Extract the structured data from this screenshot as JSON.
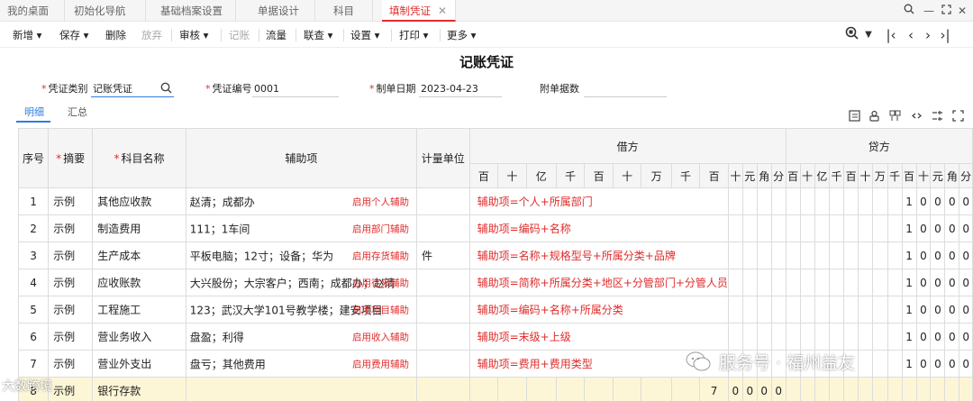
{
  "tabs": [
    {
      "label": "我的桌面"
    },
    {
      "label": "初始化导航"
    },
    {
      "label": "基础档案设置"
    },
    {
      "label": "单据设计"
    },
    {
      "label": "科目"
    },
    {
      "label": "填制凭证",
      "active": true
    }
  ],
  "toolbar": {
    "add": "新增",
    "save": "保存",
    "delete": "删除",
    "discard": "放弃",
    "review": "审核",
    "post": "记账",
    "flow": "流量",
    "query": "联查",
    "settings": "设置",
    "print": "打印",
    "more": "更多"
  },
  "voucher": {
    "title": "记账凭证",
    "type_label": "凭证类别",
    "type_value": "记账凭证",
    "number_label": "凭证编号",
    "number_value": "0001",
    "date_label": "制单日期",
    "date_value": "2023-04-23",
    "attach_label": "附单据数"
  },
  "subtabs": {
    "detail": "明细",
    "summary": "汇总"
  },
  "table": {
    "headers": {
      "seq": "序号",
      "summary": "摘要",
      "account": "科目名称",
      "aux": "辅助项",
      "unit": "计量单位",
      "debit": "借方",
      "credit": "贷方"
    },
    "digit_headers": [
      "百",
      "十",
      "亿",
      "千",
      "百",
      "十",
      "万",
      "千",
      "百",
      "十",
      "元",
      "角",
      "分"
    ],
    "rows": [
      {
        "seq": "1",
        "summary": "示例",
        "account": "其他应收款",
        "aux": "赵清；成都办",
        "aux_btn": "启用个人辅助",
        "unit": "",
        "rule": "辅助项=个人+所属部门",
        "debit_digits": "",
        "credit_digits": "10000"
      },
      {
        "seq": "2",
        "summary": "示例",
        "account": "制造费用",
        "aux": "111；1车间",
        "aux_btn": "启用部门辅助",
        "unit": "",
        "rule": "辅助项=编码+名称",
        "debit_digits": "",
        "credit_digits": "10000"
      },
      {
        "seq": "3",
        "summary": "示例",
        "account": "生产成本",
        "aux": "平板电脑；12寸；设备；华为",
        "aux_btn": "启用存货辅助",
        "unit": "件",
        "rule": "辅助项=名称+规格型号+所属分类+品牌",
        "debit_digits": "",
        "credit_digits": "10000"
      },
      {
        "seq": "4",
        "summary": "示例",
        "account": "应收账款",
        "aux": "大兴股份；大宗客户；西南；成都办；赵清",
        "aux_btn": "启用往来辅助",
        "unit": "",
        "rule": "辅助项=简称+所属分类+地区+分管部门+分管人员",
        "debit_digits": "",
        "credit_digits": "10000"
      },
      {
        "seq": "5",
        "summary": "示例",
        "account": "工程施工",
        "aux": "123；武汉大学101号教学楼；建安项目",
        "aux_btn": "启用项目辅助",
        "unit": "",
        "rule": "辅助项=编码+名称+所属分类",
        "debit_digits": "",
        "credit_digits": "10000"
      },
      {
        "seq": "6",
        "summary": "示例",
        "account": "营业务收入",
        "aux": "盘盈；利得",
        "aux_btn": "启用收入辅助",
        "unit": "",
        "rule": "辅助项=末级+上级",
        "debit_digits": "",
        "credit_digits": "10000"
      },
      {
        "seq": "7",
        "summary": "示例",
        "account": "营业外支出",
        "aux": "盘亏；其他费用",
        "aux_btn": "启用费用辅助",
        "unit": "",
        "rule": "辅助项=费用+费用类型",
        "debit_digits": "",
        "credit_digits": "10000"
      },
      {
        "seq": "8",
        "summary": "示例",
        "account": "银行存款",
        "aux": "",
        "aux_btn": "",
        "unit": "",
        "rule": "",
        "debit_digits": "70000",
        "credit_digits": ""
      }
    ]
  },
  "watermark": {
    "text": "服务号 · 福州益友",
    "corner_text": "大数跨境"
  }
}
